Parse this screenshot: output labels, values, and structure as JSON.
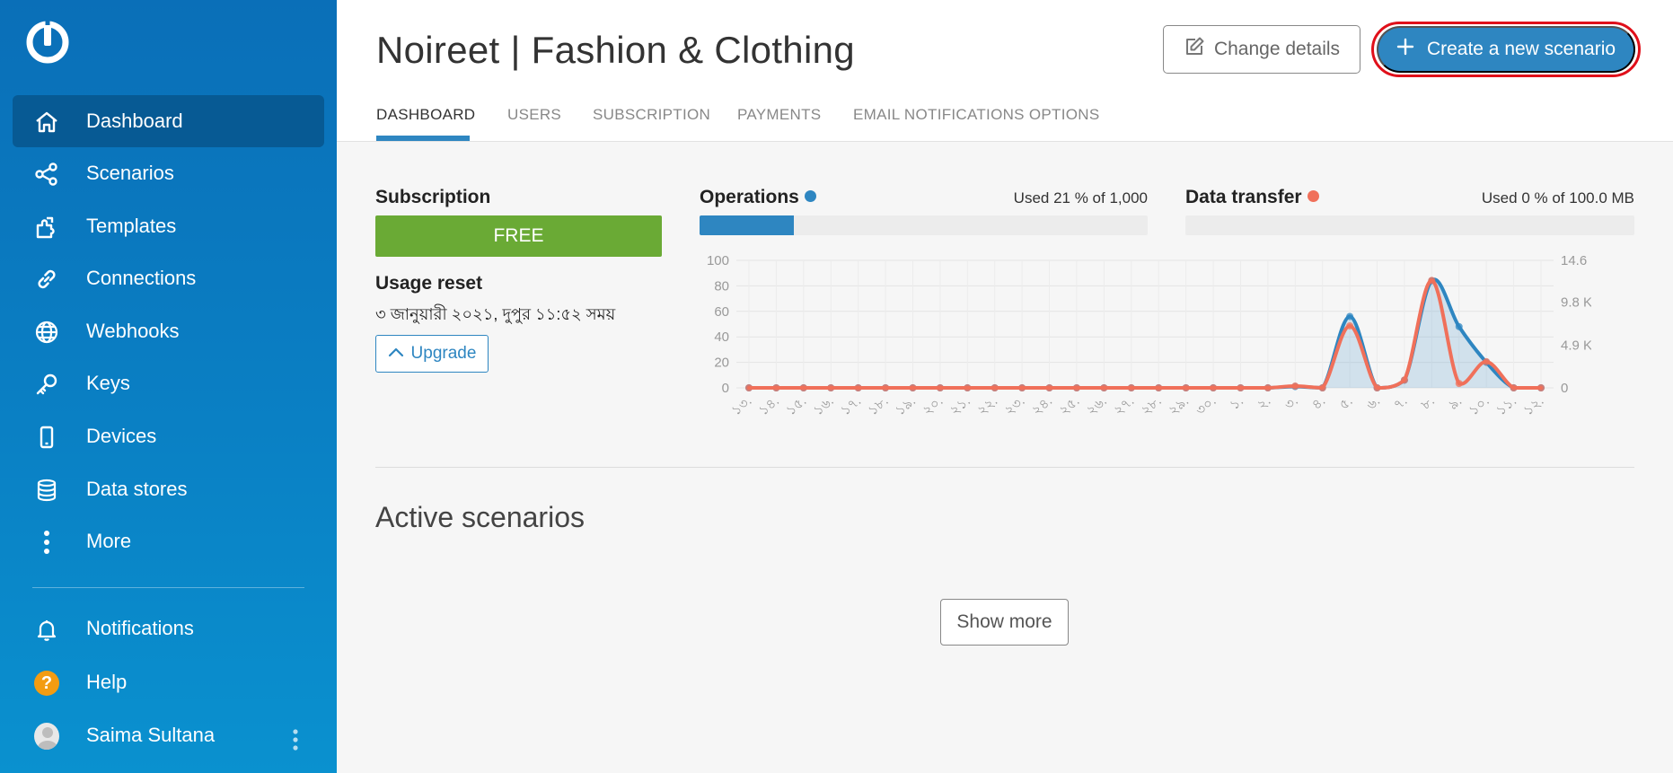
{
  "sidebar": {
    "items": [
      {
        "key": "dashboard",
        "label": "Dashboard",
        "icon": "home-icon",
        "active": true
      },
      {
        "key": "scenarios",
        "label": "Scenarios",
        "icon": "share-nodes-icon"
      },
      {
        "key": "templates",
        "label": "Templates",
        "icon": "puzzle-icon"
      },
      {
        "key": "connections",
        "label": "Connections",
        "icon": "link-icon"
      },
      {
        "key": "webhooks",
        "label": "Webhooks",
        "icon": "globe-icon"
      },
      {
        "key": "keys",
        "label": "Keys",
        "icon": "key-icon"
      },
      {
        "key": "devices",
        "label": "Devices",
        "icon": "phone-icon"
      },
      {
        "key": "datastores",
        "label": "Data stores",
        "icon": "database-icon"
      },
      {
        "key": "more",
        "label": "More",
        "icon": "vertical-dots-icon"
      }
    ],
    "bottom": {
      "notifications": "Notifications",
      "help": "Help",
      "help_glyph": "?",
      "user_name": "Saima Sultana"
    }
  },
  "header": {
    "title": "Noireet | Fashion & Clothing",
    "change_details": "Change details",
    "create_scenario": "Create a new scenario",
    "tabs": [
      "DASHBOARD",
      "USERS",
      "SUBSCRIPTION",
      "PAYMENTS",
      "EMAIL NOTIFICATIONS OPTIONS"
    ]
  },
  "subscription": {
    "label": "Subscription",
    "plan": "FREE",
    "usage_reset_label": "Usage reset",
    "usage_reset_date": "৩ জানুয়ারী ২০২১, দুপুর ১১:৫২ সময়",
    "upgrade": "Upgrade"
  },
  "operations": {
    "label": "Operations",
    "used_text": "Used 21 % of 1,000",
    "used_fraction": 0.21,
    "color": "#2e86c1"
  },
  "data_transfer": {
    "label": "Data transfer",
    "used_text": "Used 0 % of 100.0 MB",
    "used_fraction": 0,
    "color": "#f0705a"
  },
  "chart_data": {
    "type": "line",
    "x": [
      "১৩.",
      "১৪.",
      "১৫.",
      "১৬.",
      "১৭.",
      "১৮.",
      "১৯.",
      "২০.",
      "২১.",
      "২২.",
      "২৩.",
      "২৪.",
      "২৫.",
      "২৬.",
      "২৭.",
      "২৮.",
      "২৯.",
      "৩০.",
      "১.",
      "২.",
      "৩.",
      "৪.",
      "৫.",
      "৬.",
      "৭.",
      "৮.",
      "৯.",
      "১০.",
      "১১.",
      "১২."
    ],
    "y_left_ticks": [
      "0",
      "20",
      "40",
      "60",
      "80",
      "100"
    ],
    "y_right_ticks": [
      "0",
      "4.9 KB",
      "9.8 KB",
      "14.6 KB"
    ],
    "ylim_left": [
      0,
      100
    ],
    "ylim_right": [
      0,
      14.6
    ],
    "series": [
      {
        "values": [
          0,
          0,
          0,
          0,
          0,
          0,
          0,
          0,
          0,
          0,
          0,
          0,
          0,
          0,
          0,
          0,
          0,
          0,
          0,
          0,
          1,
          0,
          56,
          0,
          6,
          84,
          48,
          20,
          0,
          0
        ],
        "color": "#2e86c1",
        "axis": "left"
      },
      {
        "values": [
          0,
          0,
          0,
          0,
          0,
          0,
          0,
          0,
          0,
          0,
          0,
          0,
          0,
          0,
          0,
          0,
          0,
          0,
          0,
          0,
          0.2,
          0,
          7.1,
          0,
          0.9,
          12.3,
          0.5,
          3,
          0,
          0
        ],
        "color": "#f0705a",
        "axis": "right"
      }
    ],
    "grid": true
  },
  "active_scenarios": {
    "title": "Active scenarios",
    "show_more": "Show more"
  }
}
